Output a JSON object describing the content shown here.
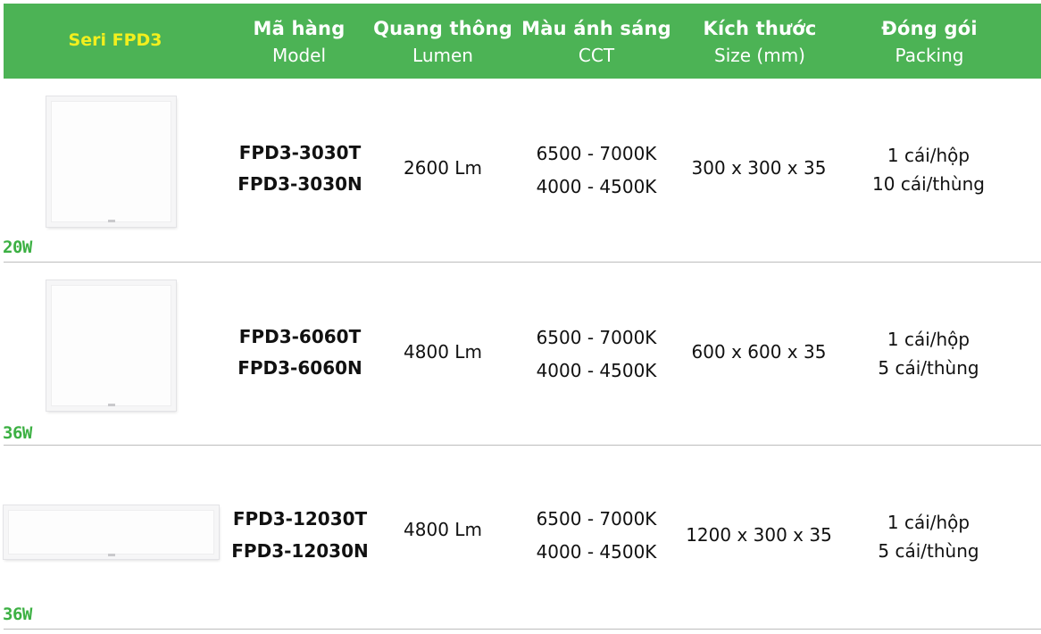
{
  "header": {
    "series_title": "Seri FPD3",
    "columns": [
      {
        "vn": "Mã hàng",
        "en": "Model"
      },
      {
        "vn": "Quang thông",
        "en": "Lumen"
      },
      {
        "vn": "Màu ánh sáng",
        "en": "CCT"
      },
      {
        "vn": "Kích thước",
        "en": "Size (mm)"
      },
      {
        "vn": "Đóng gói",
        "en": "Packing"
      }
    ]
  },
  "colors": {
    "header_bg": "#4cb355",
    "series_title": "#f2ef1e",
    "wattage": "#3cb043"
  },
  "rows": [
    {
      "wattage": "20W",
      "image": "square-led-panel-300",
      "models": [
        "FPD3-3030T",
        "FPD3-3030N"
      ],
      "lumen": "2600 Lm",
      "cct": [
        "6500 - 7000K",
        "4000 - 4500K"
      ],
      "size": "300 x 300 x 35",
      "packing": [
        "1 cái/hộp",
        "10 cái/thùng"
      ]
    },
    {
      "wattage": "36W",
      "image": "square-led-panel-600",
      "models": [
        "FPD3-6060T",
        "FPD3-6060N"
      ],
      "lumen": "4800 Lm",
      "cct": [
        "6500 - 7000K",
        "4000 - 4500K"
      ],
      "size": "600 x 600 x 35",
      "packing": [
        "1 cái/hộp",
        "5 cái/thùng"
      ]
    },
    {
      "wattage": "36W",
      "image": "rectangular-led-panel-1200",
      "models": [
        "FPD3-12030T",
        "FPD3-12030N"
      ],
      "lumen": "4800 Lm",
      "cct": [
        "6500 - 7000K",
        "4000 - 4500K"
      ],
      "size": "1200 x 300 x 35",
      "packing": [
        "1 cái/hộp",
        "5 cái/thùng"
      ]
    }
  ]
}
